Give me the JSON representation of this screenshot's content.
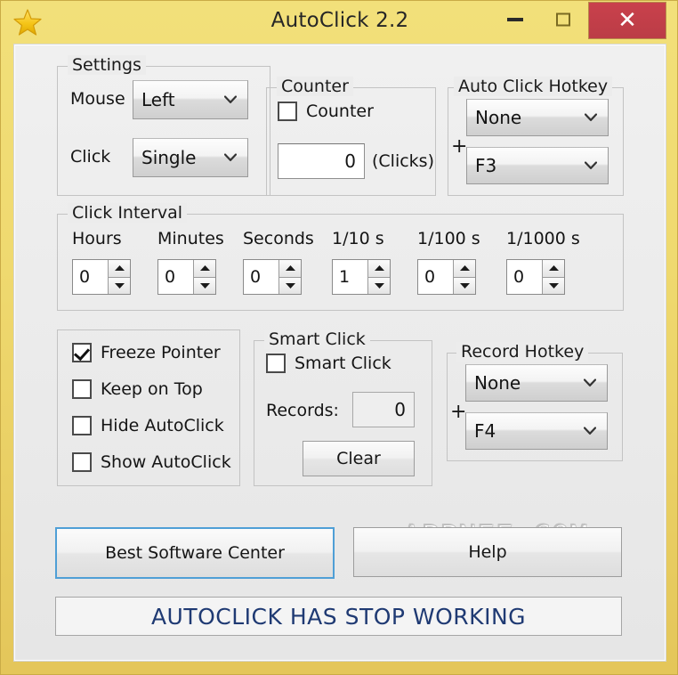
{
  "window": {
    "title": "AutoClick 2.2",
    "icon": "star-icon",
    "minimize_label": "–",
    "maximize_label": "□",
    "close_label": "✕",
    "frame_color": "#e8c860",
    "close_button_color": "#c9414c"
  },
  "settings_group": {
    "legend": "Settings",
    "mouse_label": "Mouse",
    "mouse_value": "Left",
    "click_label": "Click",
    "click_value": "Single"
  },
  "counter_group": {
    "legend": "Counter",
    "checkbox_label": "Counter",
    "checkbox_checked": false,
    "value": "0",
    "units_label": "(Clicks)"
  },
  "auto_click_hotkey_group": {
    "legend": "Auto Click Hotkey",
    "modifier_value": "None",
    "plus": "+",
    "key_value": "F3"
  },
  "click_interval_group": {
    "legend": "Click Interval",
    "fields": [
      {
        "label": "Hours",
        "value": "0"
      },
      {
        "label": "Minutes",
        "value": "0"
      },
      {
        "label": "Seconds",
        "value": "0"
      },
      {
        "label": "1/10 s",
        "value": "1"
      },
      {
        "label": "1/100 s",
        "value": "0"
      },
      {
        "label": "1/1000 s",
        "value": "0"
      }
    ]
  },
  "options_group": {
    "items": [
      {
        "label": "Freeze Pointer",
        "checked": true
      },
      {
        "label": "Keep on Top",
        "checked": false
      },
      {
        "label": "Hide AutoClick",
        "checked": false
      },
      {
        "label": "Show AutoClick",
        "checked": false
      }
    ]
  },
  "smart_click_group": {
    "legend": "Smart Click",
    "checkbox_label": "Smart Click",
    "checkbox_checked": false,
    "records_label": "Records:",
    "records_value": "0",
    "clear_button": "Clear"
  },
  "record_hotkey_group": {
    "legend": "Record Hotkey",
    "modifier_value": "None",
    "plus": "+",
    "key_value": "F4"
  },
  "footer": {
    "best_software_center_button": "Best Software Center",
    "help_button": "Help",
    "status_text": "AUTOCLICK HAS STOP WORKING",
    "status_color": "#1f3a73"
  },
  "watermark": {
    "text": "APPNEE.COM"
  }
}
